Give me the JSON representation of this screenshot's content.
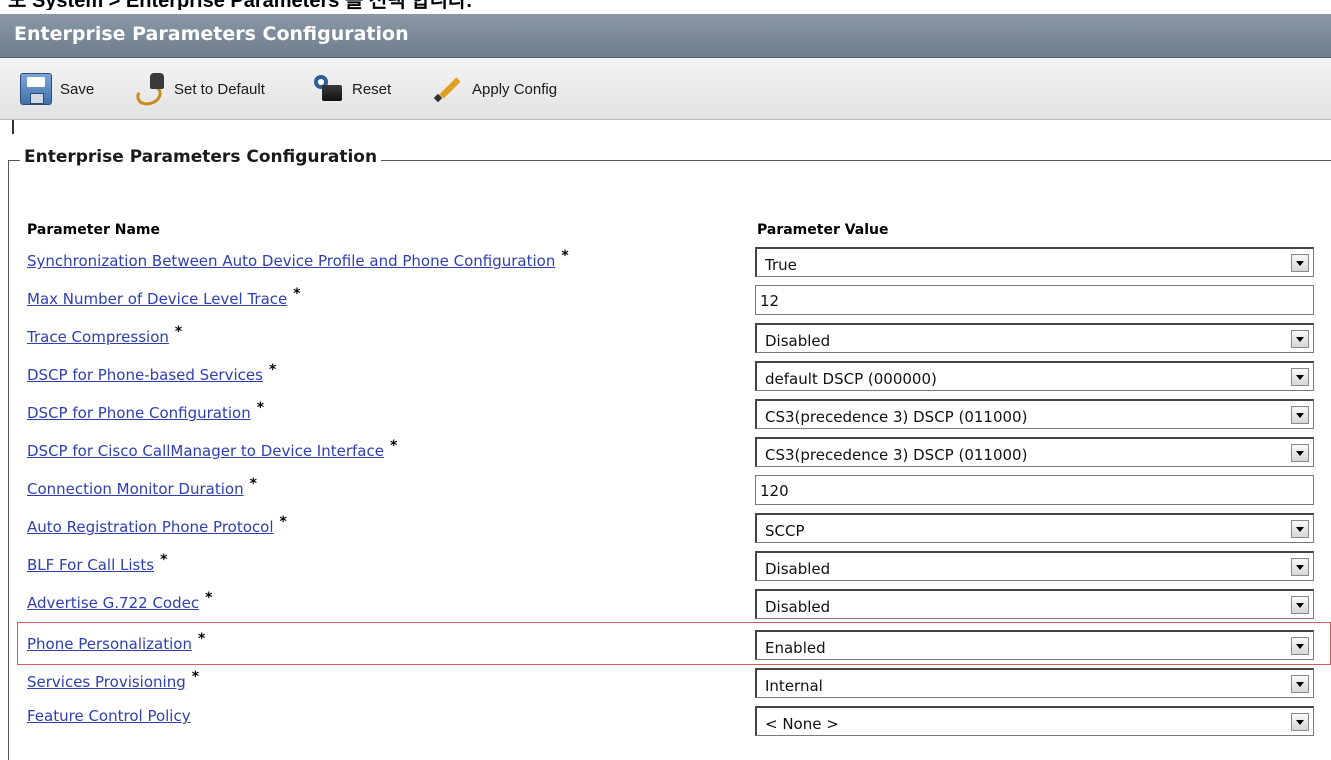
{
  "caption": "도 System > Enterprise Parameters 를 선택 합니다.",
  "window": {
    "title": "Enterprise Parameters Configuration"
  },
  "toolbar": {
    "save_label": "Save",
    "set_default_label": "Set to Default",
    "reset_label": "Reset",
    "apply_label": "Apply Config"
  },
  "section": {
    "legend": "Enterprise Parameters Configuration",
    "col_name": "Parameter Name",
    "col_value": "Parameter Value"
  },
  "params": [
    {
      "name": "Synchronization Between Auto Device Profile and Phone Configuration",
      "required": "*",
      "type": "select",
      "value": "True"
    },
    {
      "name": "Max Number of Device Level Trace",
      "required": "*",
      "type": "text",
      "value": "12"
    },
    {
      "name": "Trace Compression",
      "required": "*",
      "type": "select",
      "value": "Disabled"
    },
    {
      "name": "DSCP for Phone-based Services",
      "required": "*",
      "type": "select",
      "value": "default DSCP (000000)"
    },
    {
      "name": "DSCP for Phone Configuration",
      "required": "*",
      "type": "select",
      "value": "CS3(precedence 3) DSCP (011000)"
    },
    {
      "name": "DSCP for Cisco CallManager to Device Interface",
      "required": "*",
      "type": "select",
      "value": "CS3(precedence 3) DSCP (011000)"
    },
    {
      "name": "Connection Monitor Duration",
      "required": "*",
      "type": "text",
      "value": "120"
    },
    {
      "name": "Auto Registration Phone Protocol",
      "required": "*",
      "type": "select",
      "value": "SCCP"
    },
    {
      "name": "BLF For Call Lists",
      "required": "*",
      "type": "select",
      "value": "Disabled"
    },
    {
      "name": "Advertise G.722 Codec",
      "required": "*",
      "type": "select",
      "value": "Disabled"
    },
    {
      "name": "Phone Personalization",
      "required": "*",
      "type": "select",
      "value": "Enabled",
      "highlighted": true
    },
    {
      "name": "Services Provisioning",
      "required": "*",
      "type": "select",
      "value": "Internal"
    },
    {
      "name": "Feature Control Policy",
      "required": "",
      "type": "select",
      "value": "< None >"
    }
  ],
  "colors": {
    "title_bar": "#7a8795",
    "link": "#2e3fb0",
    "highlight_border": "#d65a5a"
  },
  "icons": [
    "save-icon",
    "set-to-default-icon",
    "reset-icon",
    "apply-config-icon"
  ]
}
